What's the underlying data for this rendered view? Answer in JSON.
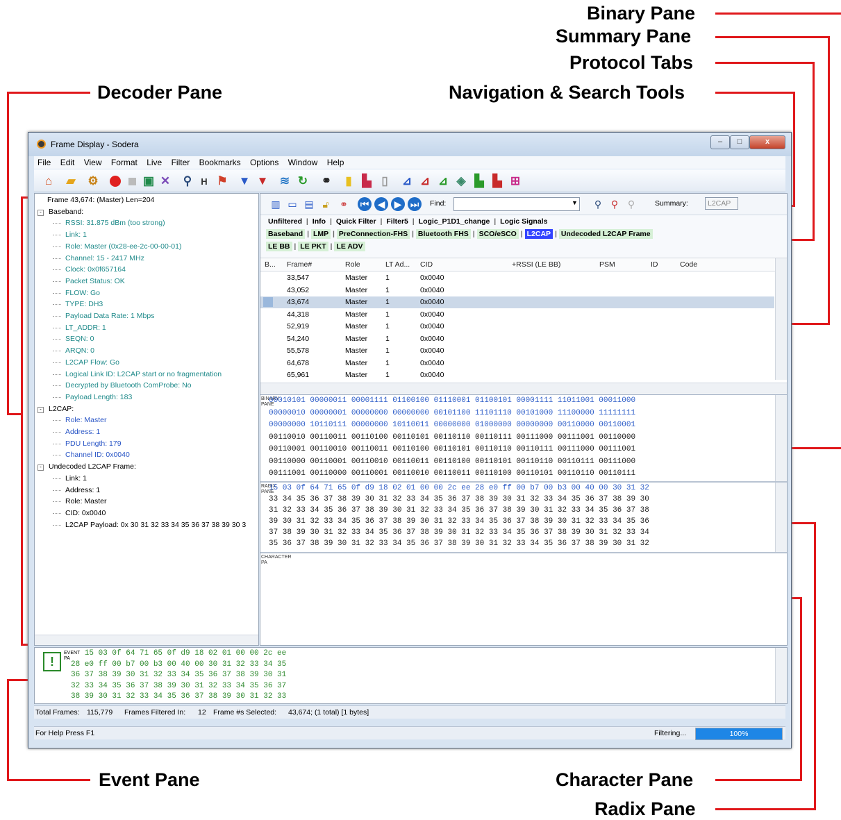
{
  "callouts": {
    "binary": "Binary Pane",
    "summary": "Summary Pane",
    "protocol_tabs": "Protocol Tabs",
    "decoder": "Decoder Pane",
    "nav_search": "Navigation & Search Tools",
    "event": "Event Pane",
    "character": "Character Pane",
    "radix": "Radix Pane"
  },
  "window": {
    "title": "Frame Display - Sodera",
    "minimize": "–",
    "maximize": "□",
    "close": "x"
  },
  "menu": [
    "File",
    "Edit",
    "View",
    "Format",
    "Live",
    "Filter",
    "Bookmarks",
    "Options",
    "Window",
    "Help"
  ],
  "decoder": {
    "lines": [
      {
        "text": "Frame 43,674: (Master) Len=204",
        "indent": 0,
        "color": "black"
      },
      {
        "text": "Baseband:",
        "indent": 1,
        "color": "black",
        "box": "-"
      },
      {
        "text": "RSSI: 31.875 dBm (too strong)",
        "indent": 2,
        "color": "teal"
      },
      {
        "text": "Link: 1",
        "indent": 2,
        "color": "teal"
      },
      {
        "text": "Role: Master (0x28-ee-2c-00-00-01)",
        "indent": 2,
        "color": "teal"
      },
      {
        "text": "Channel: 15 - 2417 MHz",
        "indent": 2,
        "color": "teal"
      },
      {
        "text": "Clock: 0x0f657164",
        "indent": 2,
        "color": "teal"
      },
      {
        "text": "Packet Status: OK",
        "indent": 2,
        "color": "teal"
      },
      {
        "text": "FLOW: Go",
        "indent": 2,
        "color": "teal"
      },
      {
        "text": "TYPE: DH3",
        "indent": 2,
        "color": "teal"
      },
      {
        "text": "Payload Data Rate: 1 Mbps",
        "indent": 2,
        "color": "teal"
      },
      {
        "text": "LT_ADDR: 1",
        "indent": 2,
        "color": "teal"
      },
      {
        "text": "SEQN: 0",
        "indent": 2,
        "color": "teal"
      },
      {
        "text": "ARQN: 0",
        "indent": 2,
        "color": "teal"
      },
      {
        "text": "L2CAP Flow: Go",
        "indent": 2,
        "color": "teal"
      },
      {
        "text": "Logical Link ID: L2CAP start or no fragmentation",
        "indent": 2,
        "color": "teal"
      },
      {
        "text": "Decrypted by Bluetooth ComProbe: No",
        "indent": 2,
        "color": "teal"
      },
      {
        "text": "Payload Length: 183",
        "indent": 2,
        "color": "teal"
      },
      {
        "text": "L2CAP:",
        "indent": 1,
        "color": "black",
        "box": "-"
      },
      {
        "text": "Role: Master",
        "indent": 2,
        "color": "blue"
      },
      {
        "text": "Address: 1",
        "indent": 2,
        "color": "blue"
      },
      {
        "text": "PDU Length: 179",
        "indent": 2,
        "color": "blue"
      },
      {
        "text": "Channel ID: 0x0040",
        "indent": 2,
        "color": "blue"
      },
      {
        "text": "Undecoded L2CAP Frame:",
        "indent": 1,
        "color": "black",
        "box": "-"
      },
      {
        "text": "Link: 1",
        "indent": 2,
        "color": "black"
      },
      {
        "text": "Address: 1",
        "indent": 2,
        "color": "black"
      },
      {
        "text": "Role: Master",
        "indent": 2,
        "color": "black"
      },
      {
        "text": "CID: 0x0040",
        "indent": 2,
        "color": "black"
      },
      {
        "text": "L2CAP Payload: 0x 30 31 32 33 34 35 36 37 38 39 30 3",
        "indent": 2,
        "color": "black"
      }
    ]
  },
  "nav": {
    "find_label": "Find:",
    "find_value": "",
    "summary_label": "Summary:",
    "summary_value": "L2CAP"
  },
  "tabs": {
    "row1": [
      "Unfiltered",
      "Info",
      "Quick Filter",
      "Filter5",
      "Logic_P1D1_change",
      "Logic Signals"
    ],
    "row2": [
      "Baseband",
      "LMP",
      "PreConnection-FHS",
      "Bluetooth FHS",
      "SCO/eSCO",
      "L2CAP",
      "Undecoded L2CAP Frame"
    ],
    "row3": [
      "LE BB",
      "LE PKT",
      "LE ADV"
    ],
    "selected": "L2CAP"
  },
  "summary": {
    "headers": [
      "B...",
      "Frame#",
      "Role",
      "LT Ad...",
      "CID",
      "+RSSI (LE BB)",
      "PSM",
      "ID",
      "Code"
    ],
    "rows": [
      [
        "33,547",
        "Master",
        "1",
        "0x0040"
      ],
      [
        "43,052",
        "Master",
        "1",
        "0x0040"
      ],
      [
        "43,674",
        "Master",
        "1",
        "0x0040"
      ],
      [
        "44,318",
        "Master",
        "1",
        "0x0040"
      ],
      [
        "52,919",
        "Master",
        "1",
        "0x0040"
      ],
      [
        "54,240",
        "Master",
        "1",
        "0x0040"
      ],
      [
        "55,578",
        "Master",
        "1",
        "0x0040"
      ],
      [
        "64,678",
        "Master",
        "1",
        "0x0040"
      ],
      [
        "65,961",
        "Master",
        "1",
        "0x0040"
      ]
    ],
    "selected_row": 2
  },
  "binary": {
    "label": "BINARY PANE",
    "lines": [
      "00010101 00000011 00001111 01100100 01110001 01100101 00001111 11011001 00011000",
      "00000010 00000001 00000000 00000000 00101100 11101110 00101000 11100000 11111111",
      "00000000 10110111 00000000 10110011 00000000 01000000 00000000 00110000 00110001",
      "00110010 00110011 00110100 00110101 00110110 00110111 00111000 00111001 00110000",
      "00110001 00110010 00110011 00110100 00110101 00110110 00110111 00111000 00111001",
      "00110000 00110001 00110010 00110011 00110100 00110101 00110110 00110111 00111000",
      "00111001 00110000 00110001 00110010 00110011 00110100 00110101 00110110 00110111"
    ]
  },
  "radix": {
    "label": "RADIX PANE",
    "lines": [
      "15 03 0f 64 71 65 0f d9 18 02 01 00 00 2c ee 28 e0 ff 00 b7 00 b3 00 40 00 30 31 32",
      "33 34 35 36 37 38 39 30 31 32 33 34 35 36 37 38 39 30 31 32 33 34 35 36 37 38 39 30",
      "31 32 33 34 35 36 37 38 39 30 31 32 33 34 35 36 37 38 39 30 31 32 33 34 35 36 37 38",
      "39 30 31 32 33 34 35 36 37 38 39 30 31 32 33 34 35 36 37 38 39 30 31 32 33 34 35 36",
      "37 38 39 30 31 32 33 34 35 36 37 38 39 30 31 32 33 34 35 36 37 38 39 30 31 32 33 34",
      "35 36 37 38 39 30 31 32 33 34 35 36 37 38 39 30 31 32 33 34 35 36 37 38 39 30 31 32"
    ]
  },
  "character": {
    "label": "CHARACTER PA"
  },
  "event": {
    "label": "EVENT PA",
    "lines": [
      "   15 03 0f 64 71 65 0f d9 18 02 01 00 00 2c ee",
      "28 e0 ff 00 b7 00 b3 00 40 00 30 31 32 33 34 35",
      "36 37 38 39 30 31 32 33 34 35 36 37 38 39 30 31",
      "32 33 34 35 36 37 38 39 30 31 32 33 34 35 36 37",
      "38 39 30 31 32 33 34 35 36 37 38 39 30 31 32 33"
    ]
  },
  "status": {
    "total_frames_label": "Total Frames:",
    "total_frames": "115,779",
    "filtered_label": "Frames Filtered In:",
    "filtered": "12",
    "selected_label": "Frame #s Selected:",
    "selected": "43,674; (1 total) [1 bytes]",
    "help": "For Help Press F1",
    "filtering": "Filtering...",
    "progress": "100%",
    "progress_value": 1.0
  },
  "colors": {
    "callout_line": "#e0181b",
    "selected_tab": "#3344ff",
    "progress_fill": "#1e86e6"
  }
}
